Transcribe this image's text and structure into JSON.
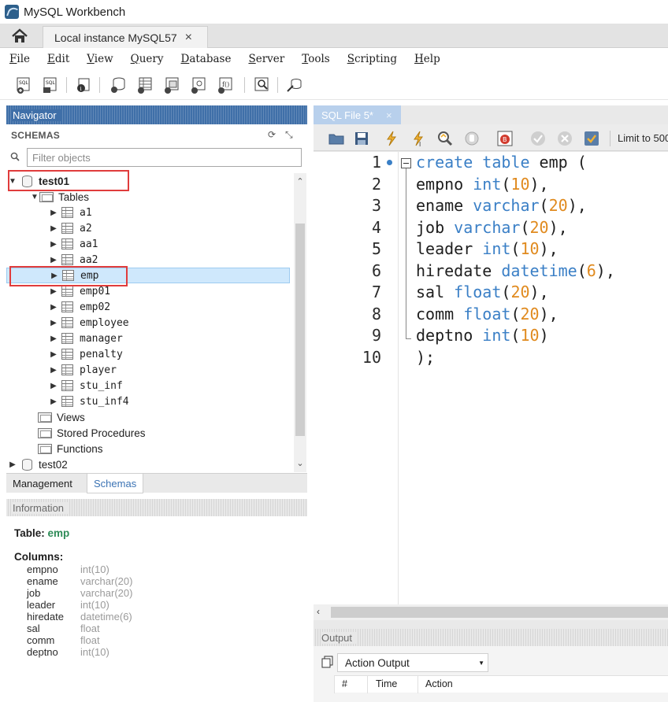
{
  "window": {
    "title": "MySQL Workbench"
  },
  "tabs": {
    "home_icon": "home-icon",
    "active_tab": "Local instance MySQL57",
    "close_glyph": "×"
  },
  "menu": [
    "File",
    "Edit",
    "View",
    "Query",
    "Database",
    "Server",
    "Tools",
    "Scripting",
    "Help"
  ],
  "navigator": {
    "header": "Navigator",
    "schemas_label": "SCHEMAS",
    "filter_placeholder": "Filter objects",
    "tree": [
      {
        "label": "test01",
        "kind": "schema",
        "expanded": true,
        "bold": true
      },
      {
        "label": "Tables",
        "kind": "folder",
        "expanded": true
      },
      {
        "label": "a1",
        "kind": "table"
      },
      {
        "label": "a2",
        "kind": "table"
      },
      {
        "label": "aa1",
        "kind": "table"
      },
      {
        "label": "aa2",
        "kind": "table"
      },
      {
        "label": "emp",
        "kind": "table",
        "selected": true
      },
      {
        "label": "emp01",
        "kind": "table"
      },
      {
        "label": "emp02",
        "kind": "table"
      },
      {
        "label": "employee",
        "kind": "table"
      },
      {
        "label": "manager",
        "kind": "table"
      },
      {
        "label": "penalty",
        "kind": "table"
      },
      {
        "label": "player",
        "kind": "table"
      },
      {
        "label": "stu_inf",
        "kind": "table"
      },
      {
        "label": "stu_inf4",
        "kind": "table"
      },
      {
        "label": "Views",
        "kind": "folder"
      },
      {
        "label": "Stored Procedures",
        "kind": "folder"
      },
      {
        "label": "Functions",
        "kind": "folder"
      },
      {
        "label": "test02",
        "kind": "schema",
        "expanded": false
      }
    ],
    "lower_tabs": [
      "Management",
      "Schemas"
    ],
    "active_lower_tab": "Schemas"
  },
  "information": {
    "header": "Information",
    "table_prefix": "Table:",
    "table_name": "emp",
    "columns_label": "Columns:",
    "columns": [
      {
        "name": "empno",
        "type": "int(10)"
      },
      {
        "name": "ename",
        "type": "varchar(20)"
      },
      {
        "name": "job",
        "type": "varchar(20)"
      },
      {
        "name": "leader",
        "type": "int(10)"
      },
      {
        "name": "hiredate",
        "type": "datetime(6)"
      },
      {
        "name": "sal",
        "type": "float"
      },
      {
        "name": "comm",
        "type": "float"
      },
      {
        "name": "deptno",
        "type": "int(10)"
      }
    ]
  },
  "editor": {
    "tab_label": "SQL File 5*",
    "tab_close": "×",
    "limit_text": "Limit to 500",
    "line_numbers": [
      "1",
      "2",
      "3",
      "4",
      "5",
      "6",
      "7",
      "8",
      "9",
      "10"
    ],
    "lines": [
      [
        {
          "t": "create table",
          "c": "kw"
        },
        {
          "t": " emp (",
          "c": ""
        }
      ],
      [
        {
          "t": "empno ",
          "c": ""
        },
        {
          "t": "int",
          "c": "kw"
        },
        {
          "t": "(",
          "c": ""
        },
        {
          "t": "10",
          "c": "num"
        },
        {
          "t": "),",
          "c": ""
        }
      ],
      [
        {
          "t": "ename ",
          "c": ""
        },
        {
          "t": "varchar",
          "c": "kw"
        },
        {
          "t": "(",
          "c": ""
        },
        {
          "t": "20",
          "c": "num"
        },
        {
          "t": "),",
          "c": ""
        }
      ],
      [
        {
          "t": "job ",
          "c": ""
        },
        {
          "t": "varchar",
          "c": "kw"
        },
        {
          "t": "(",
          "c": ""
        },
        {
          "t": "20",
          "c": "num"
        },
        {
          "t": "),",
          "c": ""
        }
      ],
      [
        {
          "t": "leader ",
          "c": ""
        },
        {
          "t": "int",
          "c": "kw"
        },
        {
          "t": "(",
          "c": ""
        },
        {
          "t": "10",
          "c": "num"
        },
        {
          "t": "),",
          "c": ""
        }
      ],
      [
        {
          "t": "hiredate ",
          "c": ""
        },
        {
          "t": "datetime",
          "c": "kw"
        },
        {
          "t": "(",
          "c": ""
        },
        {
          "t": "6",
          "c": "num"
        },
        {
          "t": "),",
          "c": ""
        }
      ],
      [
        {
          "t": "sal ",
          "c": ""
        },
        {
          "t": "float",
          "c": "kw"
        },
        {
          "t": "(",
          "c": ""
        },
        {
          "t": "20",
          "c": "num"
        },
        {
          "t": "),",
          "c": ""
        }
      ],
      [
        {
          "t": "comm ",
          "c": ""
        },
        {
          "t": "float",
          "c": "kw"
        },
        {
          "t": "(",
          "c": ""
        },
        {
          "t": "20",
          "c": "num"
        },
        {
          "t": "),",
          "c": ""
        }
      ],
      [
        {
          "t": "deptno ",
          "c": ""
        },
        {
          "t": "int",
          "c": "kw"
        },
        {
          "t": "(",
          "c": ""
        },
        {
          "t": "10",
          "c": "num"
        },
        {
          "t": ")",
          "c": ""
        }
      ],
      [
        {
          "t": ");",
          "c": ""
        }
      ]
    ]
  },
  "output": {
    "header": "Output",
    "selector": "Action Output",
    "columns": [
      "#",
      "Time",
      "Action"
    ]
  },
  "colors": {
    "navigator_header": "#3f6fa8",
    "keyword": "#3a7fc6",
    "number": "#e08a1e",
    "highlight_box": "#e03c3c",
    "selection": "#cfe8fc"
  }
}
